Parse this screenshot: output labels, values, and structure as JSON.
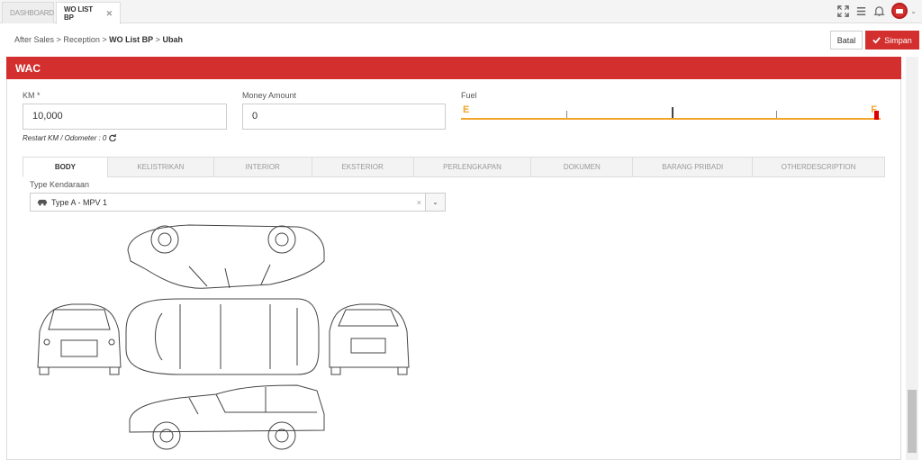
{
  "tabs": [
    {
      "label": "DASHBOARD"
    },
    {
      "label": "WO LIST BP",
      "close": "✕"
    }
  ],
  "breadcrumb": {
    "part1": "After Sales",
    "part2": "Reception",
    "part3": "WO List BP",
    "part4": "Ubah",
    "sep": ">"
  },
  "actions": {
    "batal": "Batal",
    "simpan": "Simpan"
  },
  "panel": {
    "title": "WAC"
  },
  "form": {
    "km_label": "KM *",
    "km_value": "10,000",
    "money_label": "Money Amount",
    "money_value": "0",
    "fuel_label": "Fuel",
    "fuel_e": "E",
    "fuel_f": "F",
    "restart": "Restart KM / Odometer : 0"
  },
  "subtabs": [
    "BODY",
    "KELISTRIKAN",
    "INTERIOR",
    "EKSTERIOR",
    "PERLENGKAPAN",
    "DOKUMEN",
    "BARANG PRIBADI",
    "OTHERDESCRIPTION"
  ],
  "vehicle": {
    "type_label": "Type Kendaraan",
    "type_value": "Type A - MPV 1",
    "clear": "×",
    "arrow": "⌄"
  },
  "colors": {
    "accent": "#d32f2f",
    "fuel": "#f2a42a"
  }
}
